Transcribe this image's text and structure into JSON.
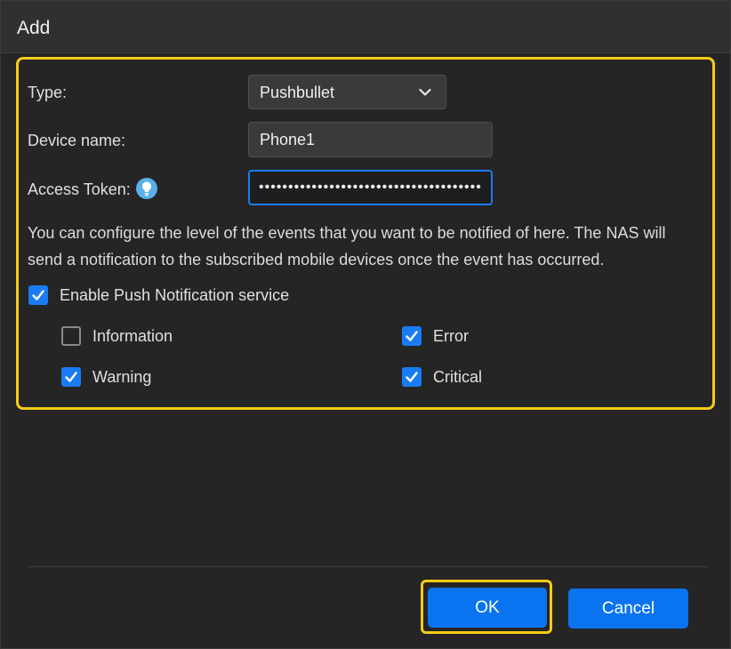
{
  "dialog": {
    "title": "Add"
  },
  "form": {
    "type_label": "Type:",
    "type_value": "Pushbullet",
    "device_label": "Device name:",
    "device_value": "Phone1",
    "token_label": "Access Token:",
    "token_value": "••••••••••••••••••••••••••••••••••••••••",
    "description": "You can configure the level of the events that you want to be notified of here. The NAS will send a notification to the subscribed mobile devices once the event has occurred."
  },
  "push": {
    "enable_label": "Enable Push Notification service",
    "enable_checked": true,
    "levels": {
      "information": {
        "label": "Information",
        "checked": false
      },
      "error": {
        "label": "Error",
        "checked": true
      },
      "warning": {
        "label": "Warning",
        "checked": true
      },
      "critical": {
        "label": "Critical",
        "checked": true
      }
    }
  },
  "footer": {
    "ok_label": "OK",
    "cancel_label": "Cancel"
  },
  "icons": {
    "type_dropdown": "chevron-down-icon",
    "token_hint": "lightbulb-icon",
    "checkbox": "check-icon"
  },
  "colors": {
    "accent": "#0a74f0",
    "highlight": "#f5cb16",
    "background": "#252525"
  }
}
